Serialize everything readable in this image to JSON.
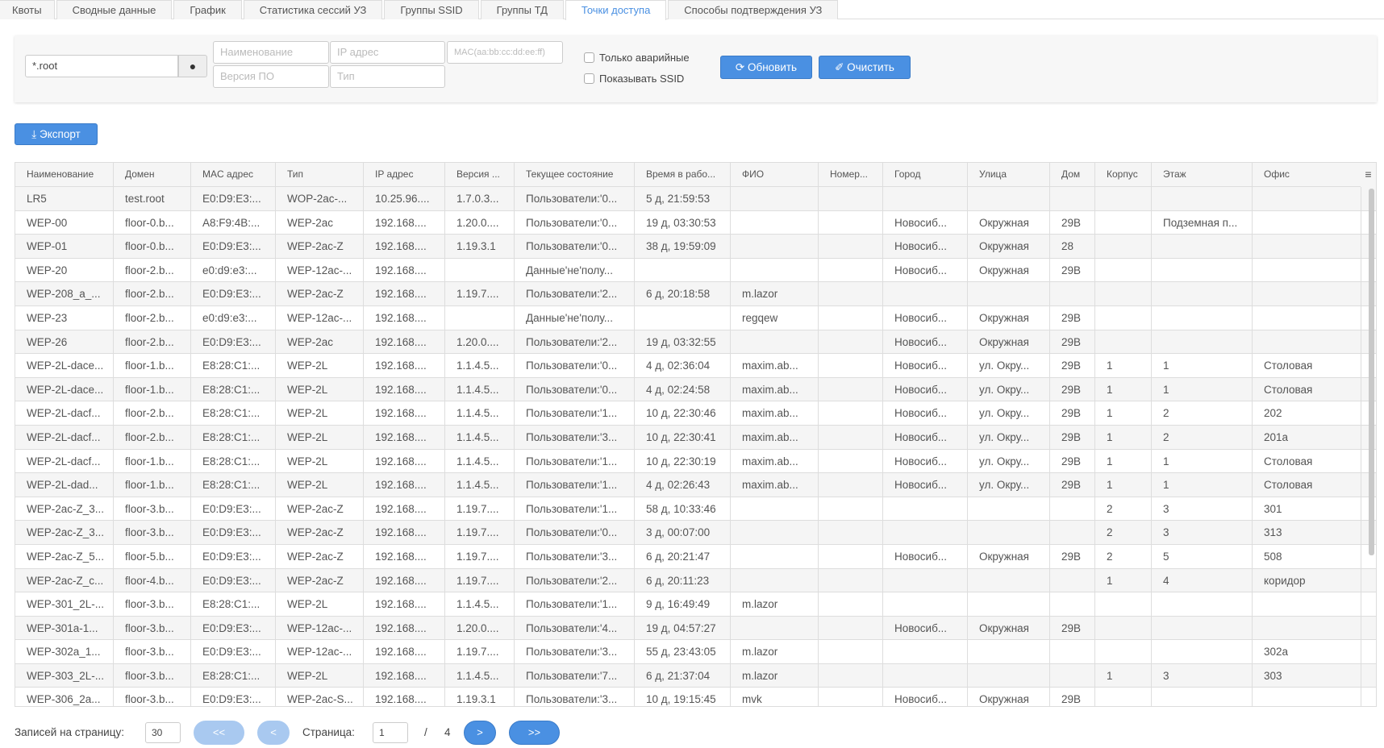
{
  "tabs": [
    "Квоты",
    "Сводные данные",
    "График",
    "Статистика сессий УЗ",
    "Группы SSID",
    "Группы ТД",
    "Точки доступа",
    "Способы подтверждения УЗ"
  ],
  "active_tab": 6,
  "filters": {
    "domain_value": "*.root",
    "name_placeholder": "Наименование",
    "ip_placeholder": "IP адрес",
    "mac_placeholder": "MAC(aa:bb:cc:dd:ee:ff)",
    "version_placeholder": "Версия ПО",
    "type_placeholder": "Тип",
    "only_alarm_label": "Только аварийные",
    "show_ssid_label": "Показывать SSID",
    "refresh_label": "Обновить",
    "clear_label": "Очистить"
  },
  "export_label": "Экспорт",
  "columns": [
    "Наименование",
    "Домен",
    "MAC адрес",
    "Тип",
    "IP адрес",
    "Версия ...",
    "Текущее состояние",
    "Время в рабо...",
    "ФИО",
    "Номер...",
    "Город",
    "Улица",
    "Дом",
    "Корпус",
    "Этаж",
    "Офис"
  ],
  "rows": [
    [
      "LR5",
      "test.root",
      "E0:D9:E3:...",
      "WOP-2ac-...",
      "10.25.96....",
      "1.7.0.3...",
      "Пользователи:'0...",
      "5 д, 21:59:53",
      "",
      "",
      "",
      "",
      "",
      "",
      "",
      ""
    ],
    [
      "WEP-00",
      "floor-0.b...",
      "A8:F9:4B:...",
      "WEP-2ac",
      "192.168....",
      "1.20.0....",
      "Пользователи:'0...",
      "19 д, 03:30:53",
      "",
      "",
      "Новосиб...",
      "Окружная",
      "29В",
      "",
      "Подземная п...",
      ""
    ],
    [
      "WEP-01",
      "floor-0.b...",
      "E0:D9:E3:...",
      "WEP-2ac-Z",
      "192.168....",
      "1.19.3.1",
      "Пользователи:'0...",
      "38 д, 19:59:09",
      "",
      "",
      "Новосиб...",
      "Окружная",
      "28",
      "",
      "",
      ""
    ],
    [
      "WEP-20",
      "floor-2.b...",
      "e0:d9:e3:...",
      "WEP-12ac-...",
      "192.168....",
      "",
      "Данные'не'полу...",
      "",
      "",
      "",
      "Новосиб...",
      "Окружная",
      "29В",
      "",
      "",
      ""
    ],
    [
      "WEP-208_a_...",
      "floor-2.b...",
      "E0:D9:E3:...",
      "WEP-2ac-Z",
      "192.168....",
      "1.19.7....",
      "Пользователи:'2...",
      "6 д, 20:18:58",
      "m.lazor",
      "",
      "",
      "",
      "",
      "",
      "",
      ""
    ],
    [
      "WEP-23",
      "floor-2.b...",
      "e0:d9:e3:...",
      "WEP-12ac-...",
      "192.168....",
      "",
      "Данные'не'полу...",
      "",
      "regqew",
      "",
      "Новосиб...",
      "Окружная",
      "29В",
      "",
      "",
      ""
    ],
    [
      "WEP-26",
      "floor-2.b...",
      "E0:D9:E3:...",
      "WEP-2ac",
      "192.168....",
      "1.20.0....",
      "Пользователи:'2...",
      "19 д, 03:32:55",
      "",
      "",
      "Новосиб...",
      "Окружная",
      "29В",
      "",
      "",
      ""
    ],
    [
      "WEP-2L-dace...",
      "floor-1.b...",
      "E8:28:C1:...",
      "WEP-2L",
      "192.168....",
      "1.1.4.5...",
      "Пользователи:'0...",
      "4 д, 02:36:04",
      "maxim.ab...",
      "",
      "Новосиб...",
      "ул. Окру...",
      "29В",
      "1",
      "1",
      "Столовая"
    ],
    [
      "WEP-2L-dace...",
      "floor-1.b...",
      "E8:28:C1:...",
      "WEP-2L",
      "192.168....",
      "1.1.4.5...",
      "Пользователи:'0...",
      "4 д, 02:24:58",
      "maxim.ab...",
      "",
      "Новосиб...",
      "ул. Окру...",
      "29В",
      "1",
      "1",
      "Столовая"
    ],
    [
      "WEP-2L-dacf...",
      "floor-2.b...",
      "E8:28:C1:...",
      "WEP-2L",
      "192.168....",
      "1.1.4.5...",
      "Пользователи:'1...",
      "10 д, 22:30:46",
      "maxim.ab...",
      "",
      "Новосиб...",
      "ул. Окру...",
      "29В",
      "1",
      "2",
      "202"
    ],
    [
      "WEP-2L-dacf...",
      "floor-2.b...",
      "E8:28:C1:...",
      "WEP-2L",
      "192.168....",
      "1.1.4.5...",
      "Пользователи:'3...",
      "10 д, 22:30:41",
      "maxim.ab...",
      "",
      "Новосиб...",
      "ул. Окру...",
      "29В",
      "1",
      "2",
      "201а"
    ],
    [
      "WEP-2L-dacf...",
      "floor-1.b...",
      "E8:28:C1:...",
      "WEP-2L",
      "192.168....",
      "1.1.4.5...",
      "Пользователи:'1...",
      "10 д, 22:30:19",
      "maxim.ab...",
      "",
      "Новосиб...",
      "ул. Окру...",
      "29В",
      "1",
      "1",
      "Столовая"
    ],
    [
      "WEP-2L-dad...",
      "floor-1.b...",
      "E8:28:C1:...",
      "WEP-2L",
      "192.168....",
      "1.1.4.5...",
      "Пользователи:'1...",
      "4 д, 02:26:43",
      "maxim.ab...",
      "",
      "Новосиб...",
      "ул. Окру...",
      "29В",
      "1",
      "1",
      "Столовая"
    ],
    [
      "WEP-2ac-Z_3...",
      "floor-3.b...",
      "E0:D9:E3:...",
      "WEP-2ac-Z",
      "192.168....",
      "1.19.7....",
      "Пользователи:'1...",
      "58 д, 10:33:46",
      "",
      "",
      "",
      "",
      "",
      "2",
      "3",
      "301"
    ],
    [
      "WEP-2ac-Z_3...",
      "floor-3.b...",
      "E0:D9:E3:...",
      "WEP-2ac-Z",
      "192.168....",
      "1.19.7....",
      "Пользователи:'0...",
      "3 д, 00:07:00",
      "",
      "",
      "",
      "",
      "",
      "2",
      "3",
      "313"
    ],
    [
      "WEP-2ac-Z_5...",
      "floor-5.b...",
      "E0:D9:E3:...",
      "WEP-2ac-Z",
      "192.168....",
      "1.19.7....",
      "Пользователи:'3...",
      "6 д, 20:21:47",
      "",
      "",
      "Новосиб...",
      "Окружная",
      "29В",
      "2",
      "5",
      "508"
    ],
    [
      "WEP-2ac-Z_c...",
      "floor-4.b...",
      "E0:D9:E3:...",
      "WEP-2ac-Z",
      "192.168....",
      "1.19.7....",
      "Пользователи:'2...",
      "6 д, 20:11:23",
      "",
      "",
      "",
      "",
      "",
      "1",
      "4",
      "коридор"
    ],
    [
      "WEP-301_2L-...",
      "floor-3.b...",
      "E8:28:C1:...",
      "WEP-2L",
      "192.168....",
      "1.1.4.5...",
      "Пользователи:'1...",
      "9 д, 16:49:49",
      "m.lazor",
      "",
      "",
      "",
      "",
      "",
      "",
      ""
    ],
    [
      "WEP-301a-1...",
      "floor-3.b...",
      "E0:D9:E3:...",
      "WEP-12ac-...",
      "192.168....",
      "1.20.0....",
      "Пользователи:'4...",
      "19 д, 04:57:27",
      "",
      "",
      "Новосиб...",
      "Окружная",
      "29В",
      "",
      "",
      ""
    ],
    [
      "WEP-302a_1...",
      "floor-3.b...",
      "E0:D9:E3:...",
      "WEP-12ac-...",
      "192.168....",
      "1.19.7....",
      "Пользователи:'3...",
      "55 д, 23:43:05",
      "m.lazor",
      "",
      "",
      "",
      "",
      "",
      "",
      "302а"
    ],
    [
      "WEP-303_2L-...",
      "floor-3.b...",
      "E8:28:C1:...",
      "WEP-2L",
      "192.168....",
      "1.1.4.5...",
      "Пользователи:'7...",
      "6 д, 21:37:04",
      "m.lazor",
      "",
      "",
      "",
      "",
      "1",
      "3",
      "303"
    ],
    [
      "WEP-306_2a...",
      "floor-3.b...",
      "E0:D9:E3:...",
      "WEP-2ac-S...",
      "192.168....",
      "1.19.3.1",
      "Пользователи:'3...",
      "10 д, 19:15:45",
      "mvk",
      "",
      "Новосиб...",
      "Окружная",
      "29В",
      "",
      "",
      ""
    ]
  ],
  "pagination": {
    "per_page_label": "Записей на страницу:",
    "per_page_value": "30",
    "first": "<<",
    "prev": "<",
    "page_label": "Страница:",
    "page_value": "1",
    "separator": "/",
    "total_pages": "4",
    "next": ">",
    "last": ">>"
  }
}
